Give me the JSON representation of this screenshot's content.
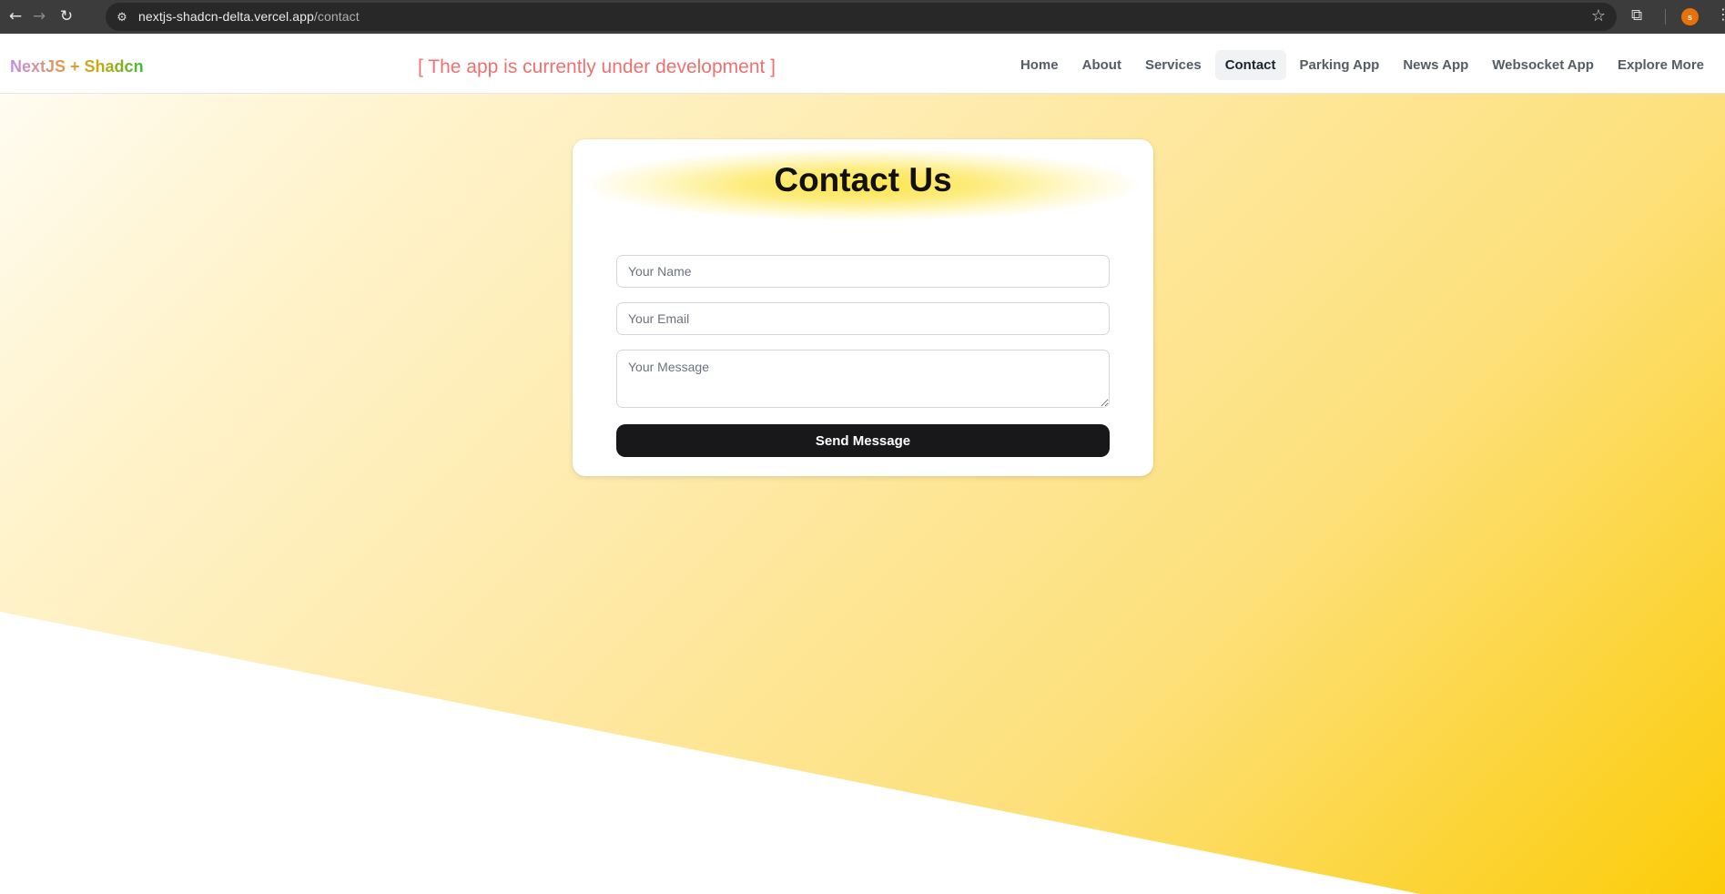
{
  "browser": {
    "back_icon": "←",
    "forward_icon": "→",
    "reload_icon": "↻",
    "site_info_icon": "⚙",
    "url_host": "nextjs-shadcn-delta.vercel.app",
    "url_path": "/contact",
    "bookmark_icon": "☆",
    "extensions_icon": "⧉",
    "profile_initial": "s",
    "menu_icon": "⋮"
  },
  "header": {
    "logo": "NextJS + Shadcn",
    "banner": "[ The app is currently under development ]",
    "nav": [
      {
        "label": "Home"
      },
      {
        "label": "About"
      },
      {
        "label": "Services"
      },
      {
        "label": "Contact"
      },
      {
        "label": "Parking App"
      },
      {
        "label": "News App"
      },
      {
        "label": "Websocket App"
      },
      {
        "label": "Explore More"
      }
    ],
    "active_nav": "Contact"
  },
  "contact_form": {
    "title": "Contact Us",
    "name_placeholder": "Your Name",
    "name_value": "",
    "email_placeholder": "Your Email",
    "email_value": "",
    "message_placeholder": "Your Message",
    "message_value": "",
    "submit_label": "Send Message"
  },
  "colors": {
    "accent_yellow": "#fccc08",
    "button_dark": "#18181b",
    "banner_red": "#ef7070"
  }
}
